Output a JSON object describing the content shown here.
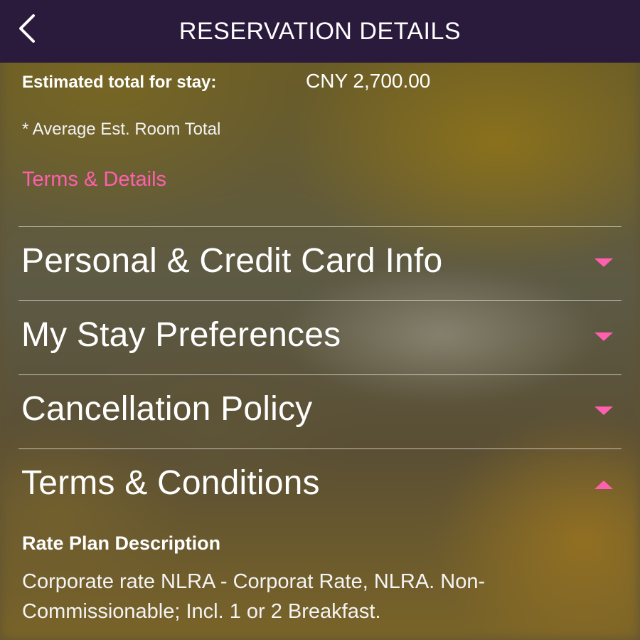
{
  "header": {
    "title": "RESERVATION DETAILS",
    "back_icon": "chevron-left-icon"
  },
  "summary": {
    "estimated_label": "Estimated total for stay:",
    "estimated_value": "CNY 2,700.00",
    "average_note": "* Average Est. Room Total",
    "terms_link": "Terms & Details"
  },
  "sections": [
    {
      "title": "Personal & Credit Card Info",
      "state": "collapsed",
      "caret_icon": "caret-down-icon"
    },
    {
      "title": "My Stay Preferences",
      "state": "collapsed",
      "caret_icon": "caret-down-icon"
    },
    {
      "title": "Cancellation Policy",
      "state": "collapsed",
      "caret_icon": "caret-down-icon"
    },
    {
      "title": "Terms & Conditions",
      "state": "expanded",
      "caret_icon": "caret-up-icon"
    }
  ],
  "terms": {
    "rate_heading": "Rate Plan Description",
    "rate_description": "Corporate rate NLRA - Corporat Rate, NLRA. Non-Commissionable; Incl. 1 or 2 Breakfast."
  },
  "colors": {
    "header_bg": "#2a1a3c",
    "accent": "#ff5fae",
    "text": "#ffffff"
  }
}
